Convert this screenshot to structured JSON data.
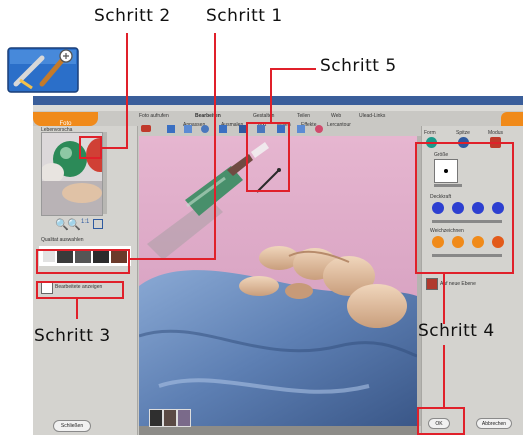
{
  "callouts": {
    "step1": "Schritt 1",
    "step2": "Schritt 2",
    "step3": "Schritt 3",
    "step4": "Schritt 4",
    "step5": "Schritt 5"
  },
  "app": {
    "tabs": [
      "Foto aufrufen",
      "Bearbeiten",
      "Gestalten",
      "Teilen",
      "Web",
      "Ulead-Links"
    ],
    "subtabs": [
      "Anpassen",
      "Ausmalen",
      "Text",
      "Malen",
      "Effekte",
      "Lercantour"
    ],
    "left_tab": "Foto",
    "left_panel": {
      "preview_label": "Lebenvorscha",
      "presets_label": "Qualitat auswahlen",
      "option_label": "Bearbeitete anzeigen",
      "bottom_button": "Schließen"
    },
    "right_panel": {
      "tools": [
        "Form",
        "Spitze",
        "Modus"
      ],
      "size_label": "Größe",
      "transparency_label": "Deckkraft",
      "soft_label": "Weichzeichnen",
      "layer_label": "Auf neue Ebene"
    },
    "buttons": {
      "ok": "OK",
      "cancel": "Abbrechen"
    }
  },
  "colors": {
    "callout": "#e0202a",
    "app_bg": "#c9c8c4",
    "accent_orange": "#f08a1a",
    "canvas_pink": "#e5b3cf",
    "blanket_blue": "#6d8fbf"
  }
}
